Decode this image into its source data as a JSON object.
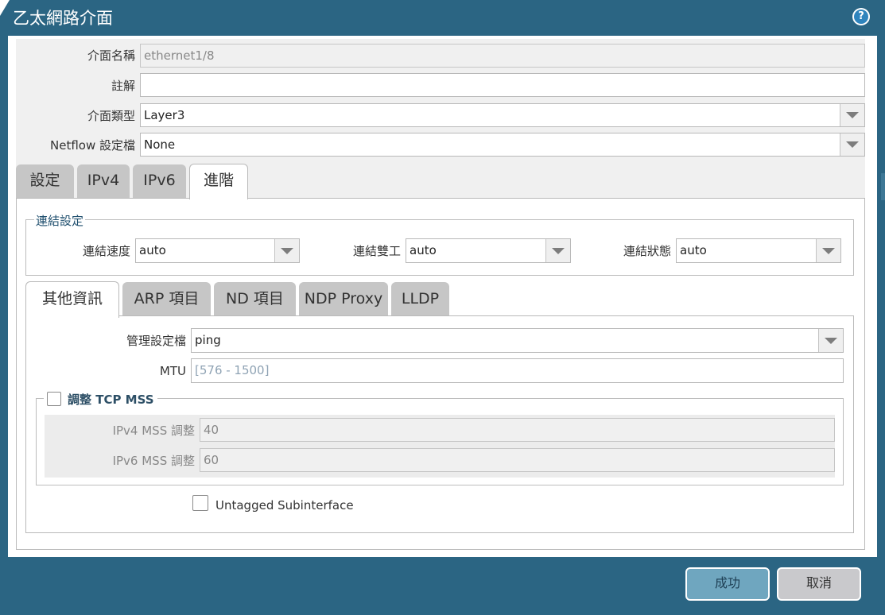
{
  "window": {
    "title": "乙太網路介面",
    "help_icon": "help-icon"
  },
  "form": {
    "interface_name_label": "介面名稱",
    "interface_name_value": "ethernet1/8",
    "comment_label": "註解",
    "comment_value": "",
    "interface_type_label": "介面類型",
    "interface_type_value": "Layer3",
    "netflow_label": "Netflow 設定檔",
    "netflow_value": "None"
  },
  "tabs": [
    "設定",
    "IPv4",
    "IPv6",
    "進階"
  ],
  "active_tab": "進階",
  "link_settings": {
    "legend": "連結設定",
    "speed_label": "連結速度",
    "speed_value": "auto",
    "duplex_label": "連結雙工",
    "duplex_value": "auto",
    "state_label": "連結狀態",
    "state_value": "auto"
  },
  "subtabs": [
    "其他資訊",
    "ARP 項目",
    "ND 項目",
    "NDP Proxy",
    "LLDP"
  ],
  "active_subtab": "其他資訊",
  "other_info": {
    "mgmt_profile_label": "管理設定檔",
    "mgmt_profile_value": "ping",
    "mtu_label": "MTU",
    "mtu_placeholder": "[576 - 1500]",
    "tcp_mss_label": "調整 TCP MSS",
    "tcp_mss_checked": false,
    "ipv4_mss_label": "IPv4 MSS 調整",
    "ipv4_mss_value": "40",
    "ipv6_mss_label": "IPv6 MSS 調整",
    "ipv6_mss_value": "60",
    "untagged_label": "Untagged Subinterface",
    "untagged_checked": false
  },
  "buttons": {
    "ok": "成功",
    "cancel": "取消"
  },
  "colors": {
    "frame": "#2b6583",
    "ok_button": "#6fa6bf",
    "cancel_button": "#c9c9cc",
    "tab_inactive": "#c6c6c6"
  }
}
